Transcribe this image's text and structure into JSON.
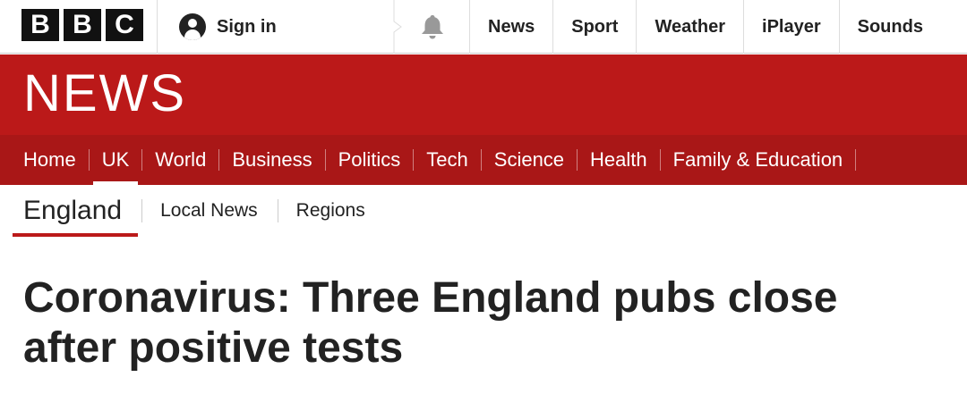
{
  "header": {
    "logo_letters": [
      "B",
      "B",
      "C"
    ],
    "sign_in_label": "Sign in",
    "bell_icon": "bell-icon",
    "top_links": [
      "News",
      "Sport",
      "Weather",
      "iPlayer",
      "Sounds"
    ]
  },
  "news_banner": {
    "logo_text": "NEWS",
    "brand_color": "#bb1919"
  },
  "nav": {
    "items": [
      "Home",
      "UK",
      "World",
      "Business",
      "Politics",
      "Tech",
      "Science",
      "Health",
      "Family & Education"
    ],
    "active": "UK"
  },
  "subnav": {
    "current": "England",
    "links": [
      "Local News",
      "Regions"
    ]
  },
  "article": {
    "headline": "Coronavirus: Three England pubs close after positive tests"
  }
}
